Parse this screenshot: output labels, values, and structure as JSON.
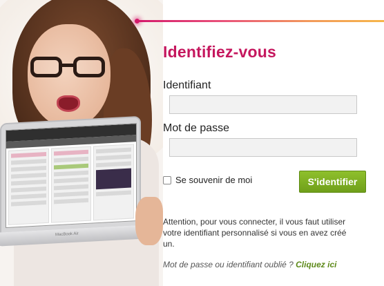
{
  "login": {
    "title": "Identifiez-vous",
    "username_label": "Identifiant",
    "username_value": "",
    "password_label": "Mot de passe",
    "password_value": "",
    "remember_label": "Se souvenir de moi",
    "remember_checked": false,
    "submit_label": "S'identifier",
    "notice": "Attention, pour vous connecter, il vous faut utiliser votre identifiant personnalisé si vous en avez créé un.",
    "forgot_prefix": "Mot de passe ou identifiant oublié ?",
    "forgot_link": "Cliquez ici"
  },
  "colors": {
    "accent": "#c5175e",
    "button_green": "#7fae22",
    "link_green": "#5e8a1a"
  },
  "hero": {
    "laptop_brand": "MacBook Air"
  }
}
